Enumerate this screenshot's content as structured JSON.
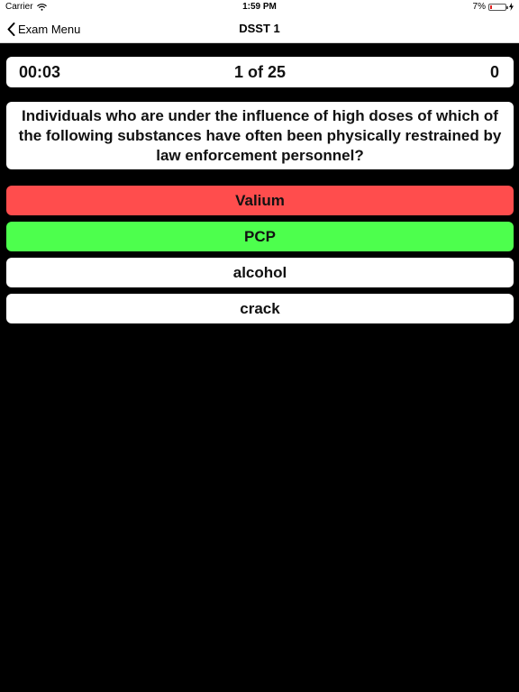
{
  "status_bar": {
    "carrier": "Carrier",
    "time": "1:59 PM",
    "battery_percent": "7%",
    "battery_level": 0.07,
    "wifi_icon": "wifi-icon",
    "charging_icon": "charging-bolt-icon"
  },
  "nav": {
    "back_label": "Exam Menu",
    "back_icon": "chevron-left-icon",
    "title": "DSST 1"
  },
  "score_bar": {
    "timer": "00:03",
    "progress": "1 of 25",
    "score": "0"
  },
  "question": {
    "text": "Individuals who are under the influence of high doses of which of the following substances have often been physically restrained by law enforcement personnel?"
  },
  "answers": [
    {
      "label": "Valium",
      "state": "wrong",
      "color": "#ff4d4d"
    },
    {
      "label": "PCP",
      "state": "correct",
      "color": "#4dff4d"
    },
    {
      "label": "alcohol",
      "state": "neutral",
      "color": "#ffffff"
    },
    {
      "label": "crack",
      "state": "neutral",
      "color": "#ffffff"
    }
  ],
  "colors": {
    "background": "#000000",
    "wrong": "#ff4d4d",
    "correct": "#4dff4d",
    "card": "#ffffff"
  }
}
